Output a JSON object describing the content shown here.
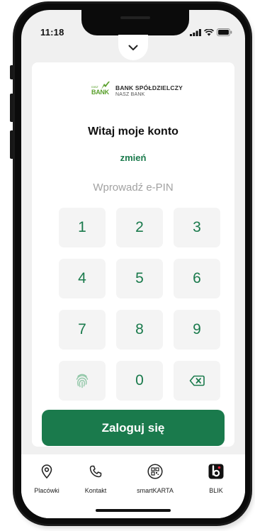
{
  "status_bar": {
    "time": "11:18"
  },
  "bank": {
    "name": "BANK SPÓŁDZIELCZY",
    "subtitle": "NASZ BANK",
    "logo_small": "nasz",
    "logo_word": "BANK"
  },
  "login": {
    "greeting": "Witaj moje konto",
    "change_link": "zmień",
    "pin_placeholder": "Wprowadź e-PIN",
    "button_label": "Zaloguj się"
  },
  "keypad": {
    "keys": [
      "1",
      "2",
      "3",
      "4",
      "5",
      "6",
      "7",
      "8",
      "9",
      "0"
    ],
    "special_keys": [
      "fingerprint-icon",
      "backspace-icon"
    ]
  },
  "bottom_nav": {
    "items": [
      {
        "label": "Placówki",
        "icon": "location-pin-icon"
      },
      {
        "label": "Kontakt",
        "icon": "phone-icon"
      },
      {
        "label": "smartKARTA",
        "icon": "qr-card-icon"
      },
      {
        "label": "BLIK",
        "icon": "blik-icon"
      }
    ]
  },
  "colors": {
    "brand_green": "#1a7a4c",
    "logo_green": "#5aa02c",
    "background": "#f0f0f0"
  }
}
